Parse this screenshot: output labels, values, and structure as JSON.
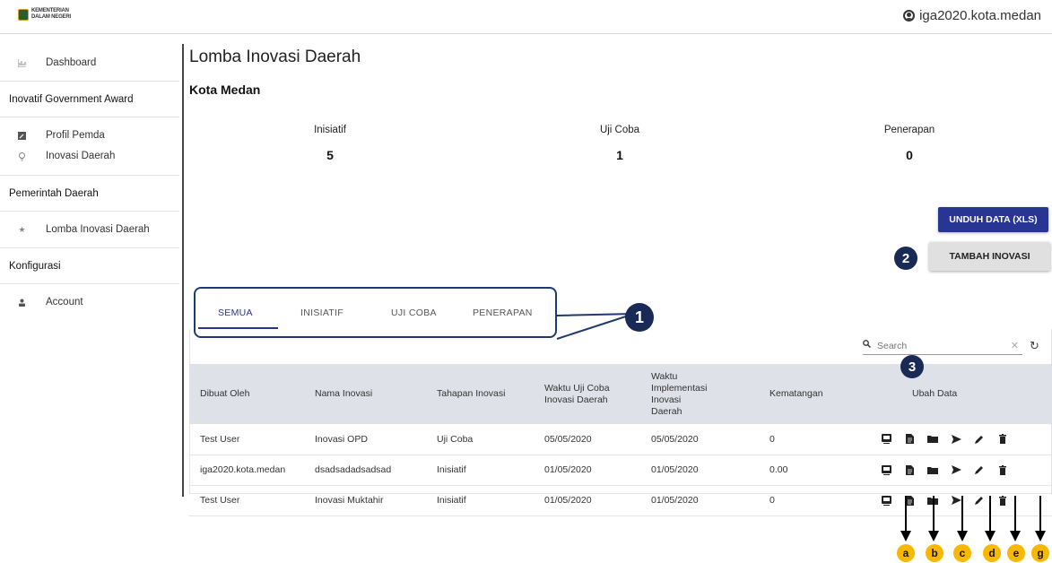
{
  "header": {
    "logo_line1": "KEMENTERIAN",
    "logo_line2": "DALAM NEGERI",
    "username": "iga2020.kota.medan"
  },
  "sidebar": {
    "dashboard": "Dashboard",
    "group1": "Inovatif Government Award",
    "profil": "Profil Pemda",
    "inovasi": "Inovasi Daerah",
    "group2": "Pemerintah Daerah",
    "lomba": "Lomba Inovasi Daerah",
    "group3": "Konfigurasi",
    "account": "Account"
  },
  "page": {
    "title": "Lomba Inovasi Daerah",
    "subtitle": "Kota Medan"
  },
  "stats": [
    {
      "label": "Inisiatif",
      "value": "5"
    },
    {
      "label": "Uji Coba",
      "value": "1"
    },
    {
      "label": "Penerapan",
      "value": "0"
    }
  ],
  "buttons": {
    "unduh": "UNDUH DATA (XLS)",
    "tambah": "TAMBAH INOVASI"
  },
  "tabs": [
    "SEMUA",
    "INISIATIF",
    "UJI COBA",
    "PENERAPAN"
  ],
  "search": {
    "placeholder": "Search"
  },
  "table": {
    "headers": [
      "Dibuat Oleh",
      "Nama Inovasi",
      "Tahapan Inovasi",
      "Waktu Uji Coba Inovasi Daerah",
      "Waktu Implementasi Inovasi Daerah",
      "Kematangan",
      "Ubah Data"
    ],
    "rows": [
      [
        "Test User",
        "Inovasi OPD",
        "Uji Coba",
        "05/05/2020",
        "05/05/2020",
        "0"
      ],
      [
        "iga2020.kota.medan",
        "dsadsadadsadsad",
        "Inisiatif",
        "01/05/2020",
        "01/05/2020",
        "0.00"
      ],
      [
        "Test User",
        "Inovasi Muktahir",
        "Inisiatif",
        "01/05/2020",
        "01/05/2020",
        "0"
      ]
    ]
  },
  "annotations": {
    "markers": [
      "1",
      "2",
      "3"
    ],
    "letters": [
      "a",
      "b",
      "c",
      "d",
      "e",
      "g"
    ]
  },
  "colors": {
    "primary": "#283593",
    "marker": "#1a2a57",
    "letter_badge": "#f9b800",
    "table_header": "#dfe1e8"
  }
}
